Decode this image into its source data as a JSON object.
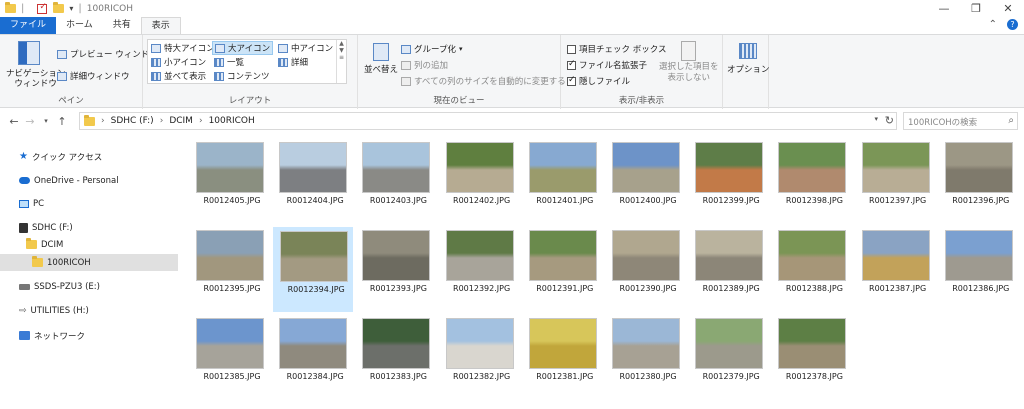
{
  "window": {
    "title": "100RICOH",
    "minimize": "—",
    "maximize": "❐",
    "close": "✕"
  },
  "tabs": [
    {
      "label": "ファイル"
    },
    {
      "label": "ホーム"
    },
    {
      "label": "共有"
    },
    {
      "label": "表示"
    }
  ],
  "ribbon": {
    "pane": {
      "nav_pane": "ナビゲーション",
      "nav_pane2": "ウィンドウ",
      "preview": "プレビュー ウィンドウ",
      "details": "詳細ウィンドウ",
      "label": "ペイン"
    },
    "layout": {
      "items": [
        "特大アイコン",
        "大アイコン",
        "中アイコン",
        "小アイコン",
        "一覧",
        "詳細",
        "並べて表示",
        "コンテンツ"
      ],
      "label": "レイアウト"
    },
    "current_view": {
      "sort": "並べ替え",
      "group": "グループ化",
      "add_column": "列の追加",
      "fit_columns": "すべての列のサイズを自動的に変更する",
      "label": "現在のビュー"
    },
    "show_hide": {
      "item_checkbox": "項目チェック ボックス",
      "file_ext": "ファイル名拡張子",
      "hidden": "隠しファイル",
      "hide_selected": "選択した項目を",
      "hide_selected2": "表示しない",
      "label": "表示/非表示"
    },
    "options": "オプション"
  },
  "address": {
    "crumbs": [
      "SDHC (F:)",
      "DCIM",
      "100RICOH"
    ],
    "search_placeholder": "100RICOHの検索"
  },
  "nav": [
    {
      "label": "クイック アクセス"
    },
    {
      "label": "OneDrive - Personal"
    },
    {
      "label": "PC"
    },
    {
      "label": "SDHC (F:)"
    },
    {
      "label": "DCIM"
    },
    {
      "label": "100RICOH"
    },
    {
      "label": "SSDS-PZU3 (E:)"
    },
    {
      "label": "UTILITIES (H:)"
    },
    {
      "label": "ネットワーク"
    }
  ],
  "files": [
    {
      "name": "R0012405.JPG",
      "sky": "#9bb4c9",
      "ground": "#8a8f80"
    },
    {
      "name": "R0012404.JPG",
      "sky": "#b9cde0",
      "ground": "#7d7f82"
    },
    {
      "name": "R0012403.JPG",
      "sky": "#a9c4dc",
      "ground": "#8a8a86"
    },
    {
      "name": "R0012402.JPG",
      "sky": "#5f7f3f",
      "ground": "#b6ab92"
    },
    {
      "name": "R0012401.JPG",
      "sky": "#87a9d1",
      "ground": "#9a9b6c"
    },
    {
      "name": "R0012400.JPG",
      "sky": "#6d93c8",
      "ground": "#a7a18c"
    },
    {
      "name": "R0012399.JPG",
      "sky": "#5e7d48",
      "ground": "#c27a48"
    },
    {
      "name": "R0012398.JPG",
      "sky": "#6a8f50",
      "ground": "#b08a6e"
    },
    {
      "name": "R0012397.JPG",
      "sky": "#7b9657",
      "ground": "#b8ad95"
    },
    {
      "name": "R0012396.JPG",
      "sky": "#9c9785",
      "ground": "#7f7a6c"
    },
    {
      "name": "R0012395.JPG",
      "sky": "#8aa0b5",
      "ground": "#a1977e"
    },
    {
      "name": "R0012394.JPG",
      "sky": "#7a8458",
      "ground": "#a39a82"
    },
    {
      "name": "R0012393.JPG",
      "sky": "#8f8b7c",
      "ground": "#6d6b60"
    },
    {
      "name": "R0012392.JPG",
      "sky": "#5f7a46",
      "ground": "#a8a49a"
    },
    {
      "name": "R0012391.JPG",
      "sky": "#6a8a4c",
      "ground": "#a69a7f"
    },
    {
      "name": "R0012390.JPG",
      "sky": "#b0a78f",
      "ground": "#8e8778"
    },
    {
      "name": "R0012389.JPG",
      "sky": "#bab39e",
      "ground": "#8c8678"
    },
    {
      "name": "R0012388.JPG",
      "sky": "#7b9555",
      "ground": "#a69678"
    },
    {
      "name": "R0012387.JPG",
      "sky": "#8aa3c3",
      "ground": "#c2a25a"
    },
    {
      "name": "R0012386.JPG",
      "sky": "#7ba0d0",
      "ground": "#9e9a90"
    },
    {
      "name": "R0012385.JPG",
      "sky": "#6c95cd",
      "ground": "#a6a39a"
    },
    {
      "name": "R0012384.JPG",
      "sky": "#86a8d5",
      "ground": "#8f8a7e"
    },
    {
      "name": "R0012383.JPG",
      "sky": "#3e5e3a",
      "ground": "#6c6f6a"
    },
    {
      "name": "R0012382.JPG",
      "sky": "#a3c1e0",
      "ground": "#d9d6cf"
    },
    {
      "name": "R0012381.JPG",
      "sky": "#d7c65a",
      "ground": "#c1a63b"
    },
    {
      "name": "R0012380.JPG",
      "sky": "#9bb7d6",
      "ground": "#a7a194"
    },
    {
      "name": "R0012379.JPG",
      "sky": "#8aa873",
      "ground": "#9c9a8c"
    },
    {
      "name": "R0012378.JPG",
      "sky": "#5d7f45",
      "ground": "#9a8e74"
    }
  ]
}
